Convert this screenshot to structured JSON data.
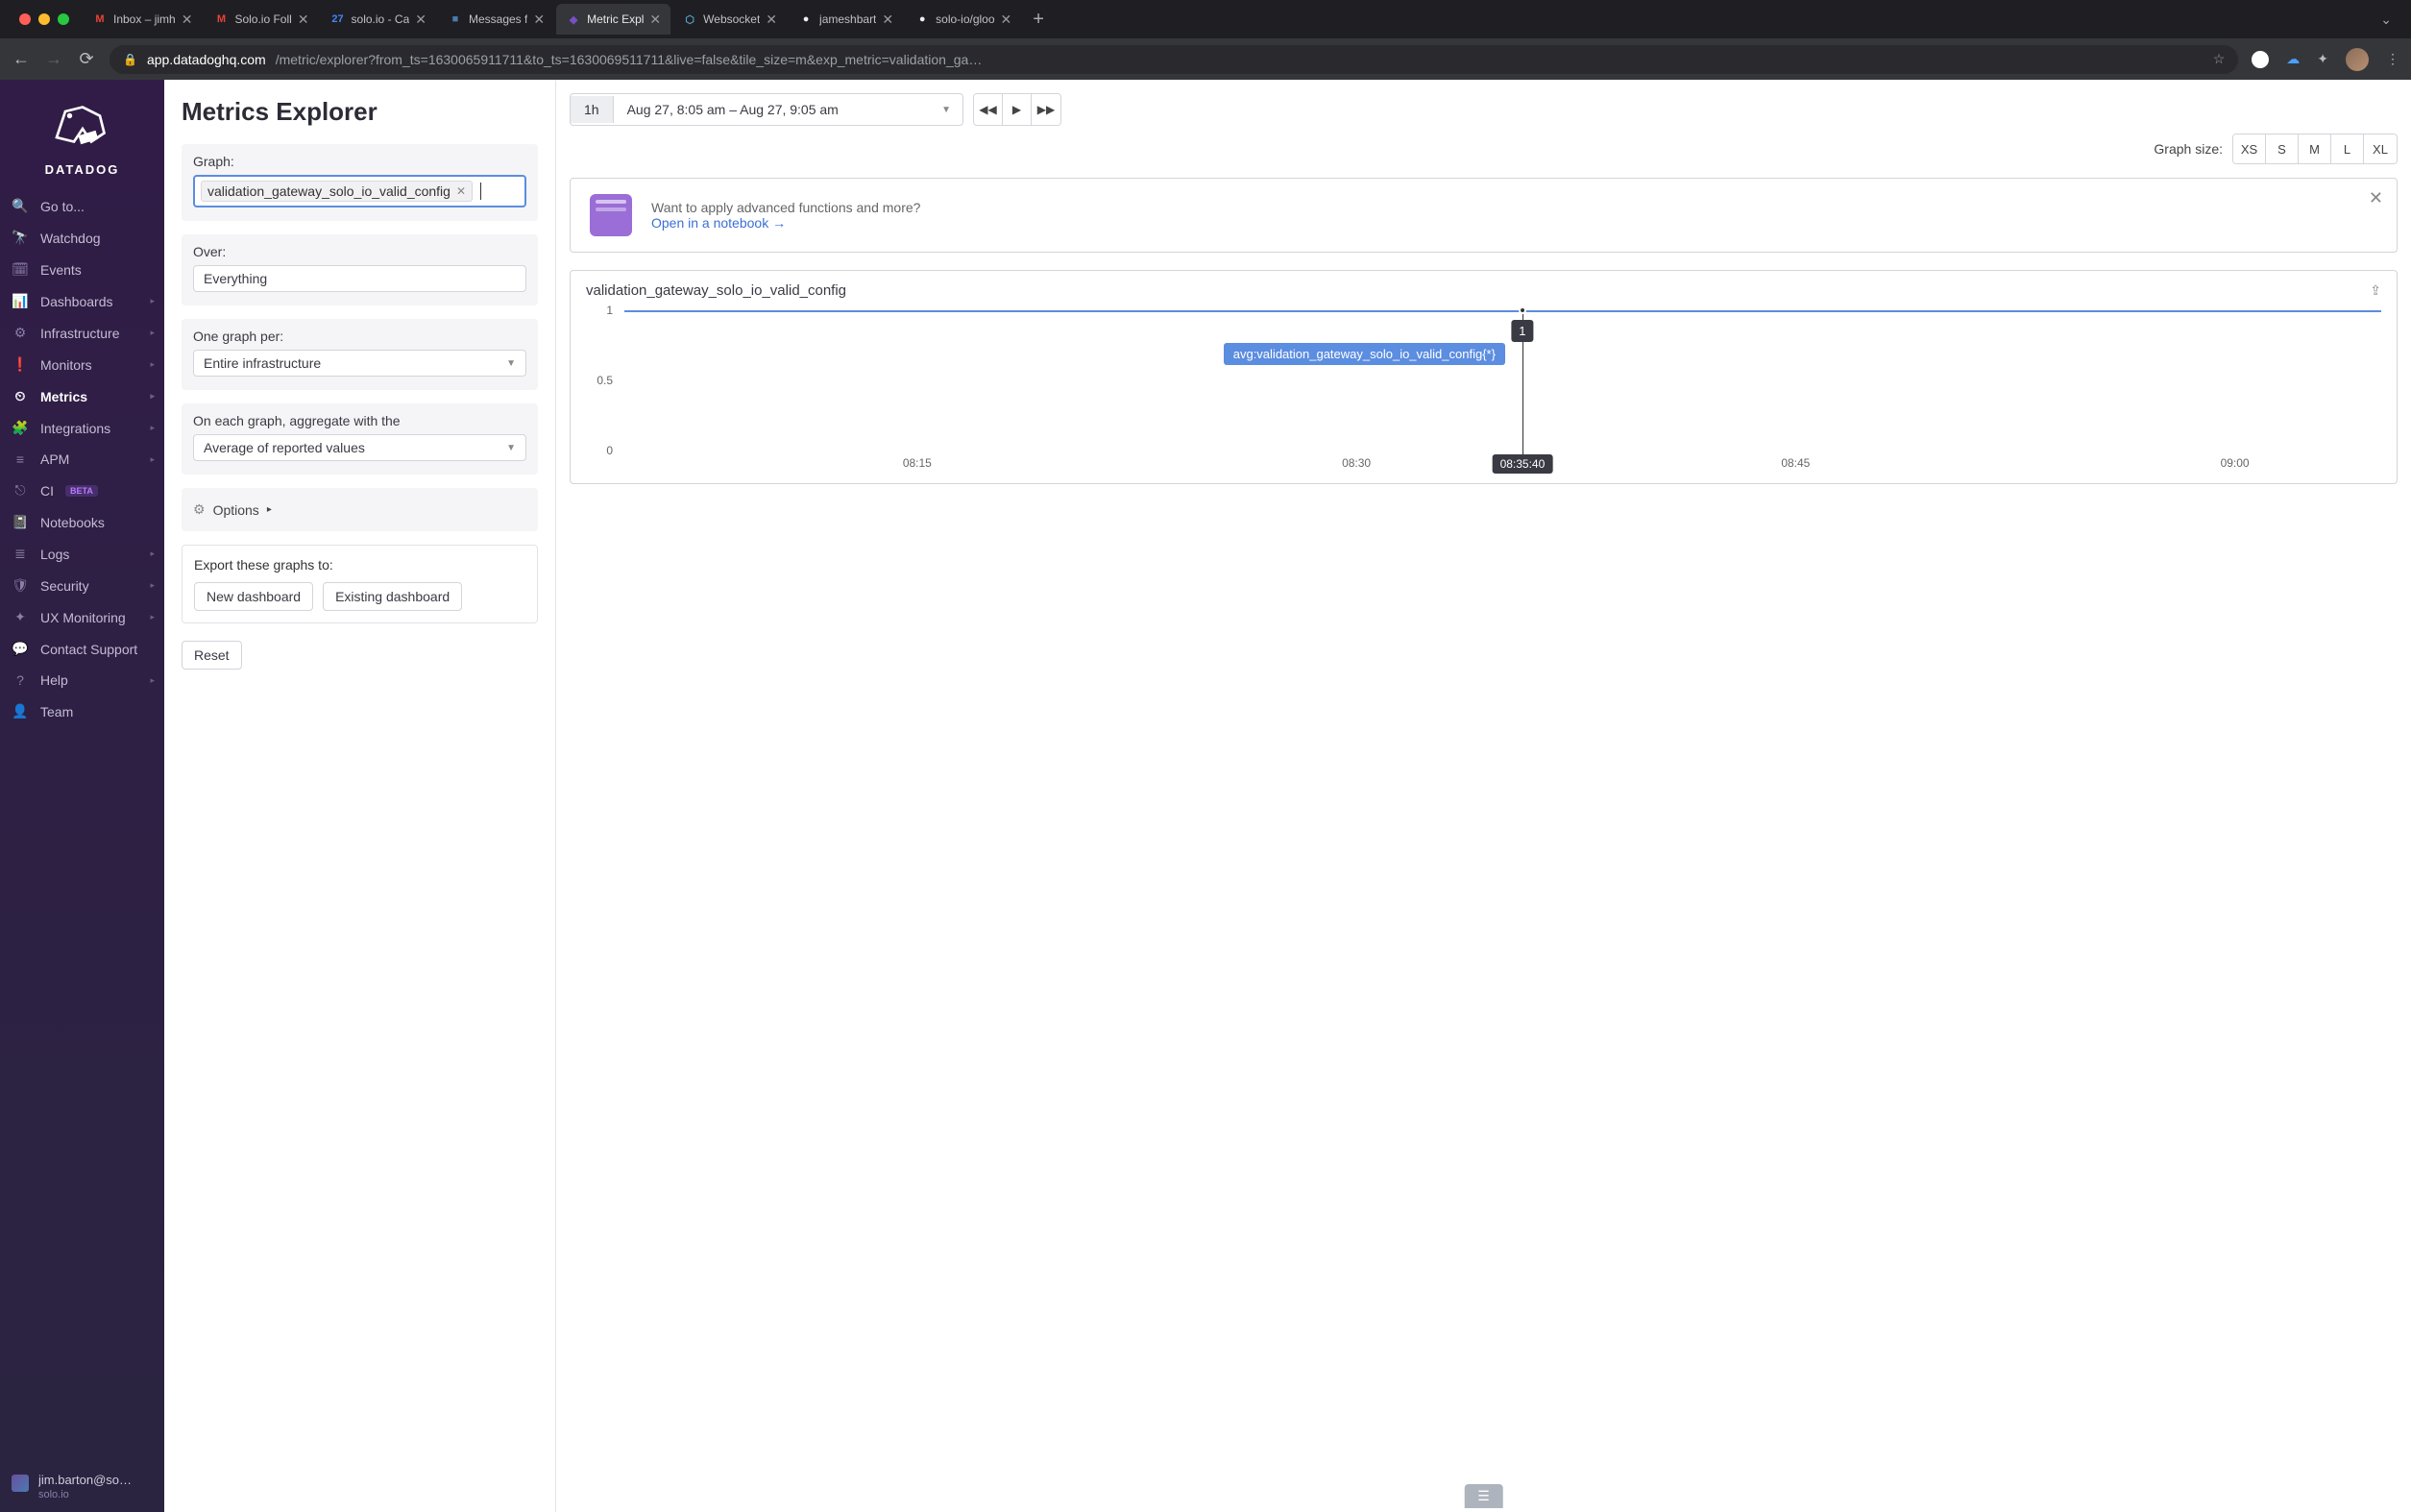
{
  "browser": {
    "tabs": [
      {
        "title": "Inbox – jimh",
        "icon": "M",
        "icon_color": "#ea4335"
      },
      {
        "title": "Solo.io Foll",
        "icon": "M",
        "icon_color": "#ea4335"
      },
      {
        "title": "solo.io - Ca",
        "icon": "27",
        "icon_color": "#4285f4"
      },
      {
        "title": "Messages f",
        "icon": "■",
        "icon_color": "#4a7ab0"
      },
      {
        "title": "Metric Expl",
        "icon": "◆",
        "icon_color": "#7a4fc4",
        "active": true
      },
      {
        "title": "Websocket",
        "icon": "⬡",
        "icon_color": "#5aa0c8"
      },
      {
        "title": "jameshbart",
        "icon": "●",
        "icon_color": "#f0f0f0"
      },
      {
        "title": "solo-io/gloo",
        "icon": "●",
        "icon_color": "#f0f0f0"
      }
    ],
    "url_domain": "app.datadoghq.com",
    "url_path": "/metric/explorer?from_ts=1630065911711&to_ts=1630069511711&live=false&tile_size=m&exp_metric=validation_ga…"
  },
  "sidebar": {
    "brand": "DATADOG",
    "items": [
      {
        "label": "Go to...",
        "icon": "search"
      },
      {
        "label": "Watchdog",
        "icon": "binoculars"
      },
      {
        "label": "Events",
        "icon": "calendar"
      },
      {
        "label": "Dashboards",
        "icon": "chart",
        "chev": true
      },
      {
        "label": "Infrastructure",
        "icon": "boxes",
        "chev": true
      },
      {
        "label": "Monitors",
        "icon": "alert",
        "chev": true
      },
      {
        "label": "Metrics",
        "icon": "gauge",
        "chev": true,
        "active": true
      },
      {
        "label": "Integrations",
        "icon": "puzzle",
        "chev": true
      },
      {
        "label": "APM",
        "icon": "apm",
        "chev": true
      },
      {
        "label": "CI",
        "icon": "ci",
        "beta": "BETA"
      },
      {
        "label": "Notebooks",
        "icon": "book"
      },
      {
        "label": "Logs",
        "icon": "logs",
        "chev": true
      },
      {
        "label": "Security",
        "icon": "shield",
        "chev": true
      },
      {
        "label": "UX Monitoring",
        "icon": "ux",
        "chev": true
      },
      {
        "label": "Contact Support",
        "icon": "chat"
      },
      {
        "label": "Help",
        "icon": "help",
        "chev": true
      },
      {
        "label": "Team",
        "icon": "team"
      }
    ],
    "user_email": "jim.barton@so…",
    "user_org": "solo.io"
  },
  "config": {
    "page_title": "Metrics Explorer",
    "graph_label": "Graph:",
    "graph_metric": "validation_gateway_solo_io_valid_config",
    "over_label": "Over:",
    "over_value": "Everything",
    "group_label": "One graph per:",
    "group_value": "Entire infrastructure",
    "agg_label": "On each graph, aggregate with the",
    "agg_value": "Average of reported values",
    "options_label": "Options",
    "export_label": "Export these graphs to:",
    "export_new": "New dashboard",
    "export_existing": "Existing dashboard",
    "reset_label": "Reset"
  },
  "main": {
    "time_preset": "1h",
    "time_range": "Aug 27, 8:05 am – Aug 27, 9:05 am",
    "size_label": "Graph size:",
    "sizes": [
      "XS",
      "S",
      "M",
      "L",
      "XL"
    ],
    "banner_q": "Want to apply advanced functions and more?",
    "banner_link": "Open in a notebook →",
    "chart_title": "validation_gateway_solo_io_valid_config",
    "hover_value": "1",
    "hover_series": "avg:validation_gateway_solo_io_valid_config{*}",
    "hover_time": "08:35:40"
  },
  "chart_data": {
    "type": "line",
    "title": "validation_gateway_solo_io_valid_config",
    "x_ticks": [
      "08:15",
      "08:30",
      "08:45",
      "09:00"
    ],
    "y_ticks": [
      0,
      0.5,
      1
    ],
    "ylim": [
      0,
      1
    ],
    "xlim_minutes": [
      5,
      65
    ],
    "series": [
      {
        "name": "avg:validation_gateway_solo_io_valid_config{*}",
        "color": "#5b8de0",
        "constant_value": 1
      }
    ],
    "hover_point": {
      "x_minute": 35.67,
      "value": 1,
      "time_label": "08:35:40"
    }
  },
  "icons": {
    "search": "🔍",
    "binoculars": "🔭",
    "calendar": "🗓",
    "chart": "📊",
    "boxes": "⚙",
    "alert": "❗",
    "gauge": "⏲",
    "puzzle": "🧩",
    "apm": "≡",
    "ci": "⎋",
    "book": "📓",
    "logs": "≣",
    "shield": "🛡",
    "ux": "✦",
    "chat": "💬",
    "help": "?",
    "team": "👤"
  }
}
